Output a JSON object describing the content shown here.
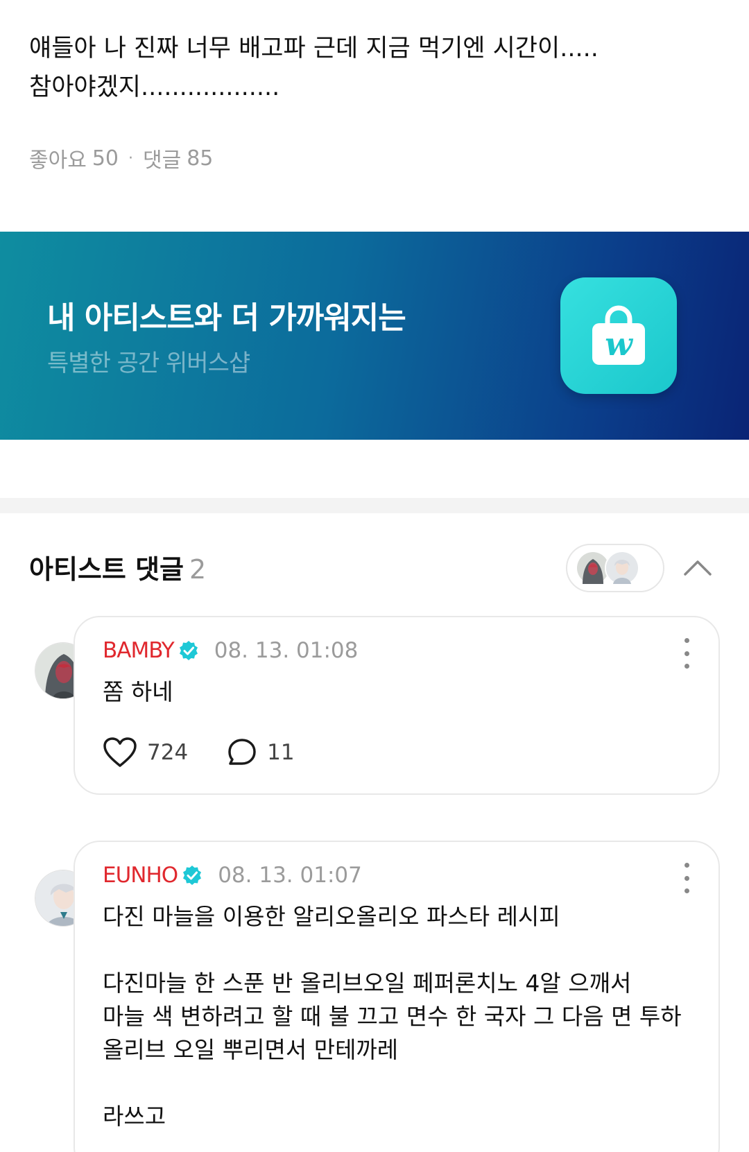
{
  "post": {
    "body": "얘들아 나 진짜 너무 배고파 근데 지금 먹기엔 시간이.....\n참아야겠지..................",
    "likes_label": "좋아요",
    "likes_count": "50",
    "separator": "·",
    "comments_label": "댓글",
    "comments_count": "85"
  },
  "banner": {
    "title": "내 아티스트와 더 가까워지는",
    "subtitle": "특별한 공간 위버스샵",
    "icon": "weverse-shop-bag-icon",
    "icon_letter": "w"
  },
  "artist_comments": {
    "title": "아티스트 댓글",
    "count": "2",
    "comments": [
      {
        "author": "BAMBY",
        "timestamp": "08. 13. 01:08",
        "text": "쫌 하네",
        "likes": "724",
        "replies": "11"
      },
      {
        "author": "EUNHO",
        "timestamp": "08. 13. 01:07",
        "text": "다진 마늘을 이용한 알리오올리오 파스타 레시피\n\n다진마늘 한 스푼 반 올리브오일 페퍼론치노 4알 으깨서\n마늘 색 변하려고 할 때 불 끄고 면수 한 국자 그 다음 면 투하\n올리브 오일 뿌리면서 만테까레\n\n라쓰고"
      }
    ]
  },
  "colors": {
    "author_red": "#e0282e",
    "verified_cyan": "#1ec8d6",
    "banner_start": "#0f8da0",
    "banner_end": "#0a2475",
    "muted_gray": "#9b9b9b"
  }
}
